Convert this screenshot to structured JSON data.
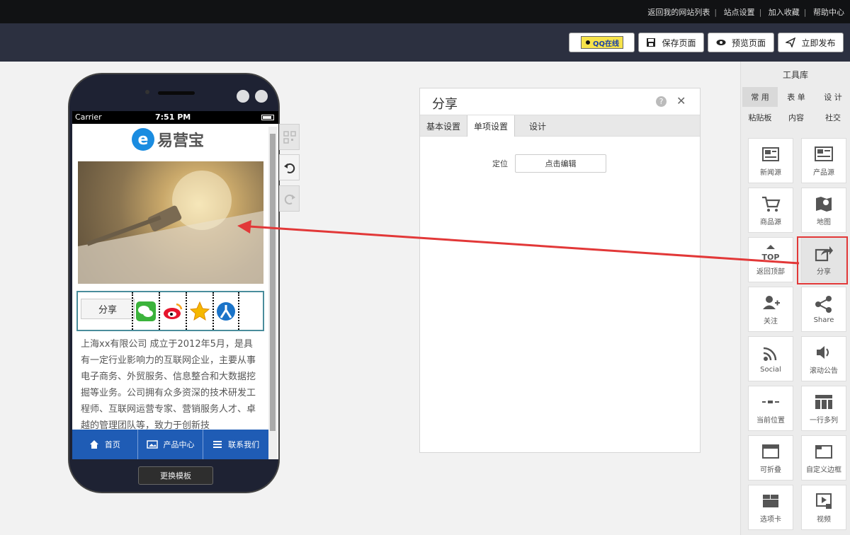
{
  "top_links": [
    "返回我的网站列表",
    "站点设置",
    "加入收藏",
    "帮助中心"
  ],
  "header": {
    "qq_label": "QQ在线",
    "save_label": "保存页面",
    "preview_label": "预览页面",
    "publish_label": "立即发布"
  },
  "phone": {
    "carrier": "Carrier",
    "time": "7:51 PM",
    "logo_text": "易营宝",
    "share_button": "分享",
    "share_icons": [
      "wechat-icon",
      "weibo-icon",
      "qzone-icon",
      "renren-icon"
    ],
    "paragraph": "上海xx有限公司 成立于2012年5月，是具有一定行业影响力的互联网企业，主要从事电子商务、外贸服务、信息整合和大数据挖掘等业务。公司拥有众多资深的技术研发工程师、互联网运营专家、营销服务人才、卓越的管理团队等，致力于创新技",
    "nav": [
      "首页",
      "产品中心",
      "联系我们"
    ],
    "swap_template": "更换模板"
  },
  "panel": {
    "title": "分享",
    "tabs": [
      "基本设置",
      "单项设置",
      "设计"
    ],
    "position_label": "定位",
    "edit_button": "点击编辑"
  },
  "toolbox": {
    "title": "工具库",
    "categories": [
      "常 用",
      "表 单",
      "设 计",
      "粘贴板",
      "内容",
      "社交"
    ],
    "items": [
      "新闻源",
      "产品源",
      "商品源",
      "地图",
      "返回顶部",
      "分享",
      "关注",
      "Share",
      "Social",
      "滚动公告",
      "当前位置",
      "一行多列",
      "可折叠",
      "自定义边框",
      "选项卡",
      "视频"
    ]
  },
  "colors": {
    "header_bg": "#2c3040",
    "topbar_bg": "#111214",
    "nav_blue": "#1f5cb5",
    "highlight_red": "#e23838"
  }
}
